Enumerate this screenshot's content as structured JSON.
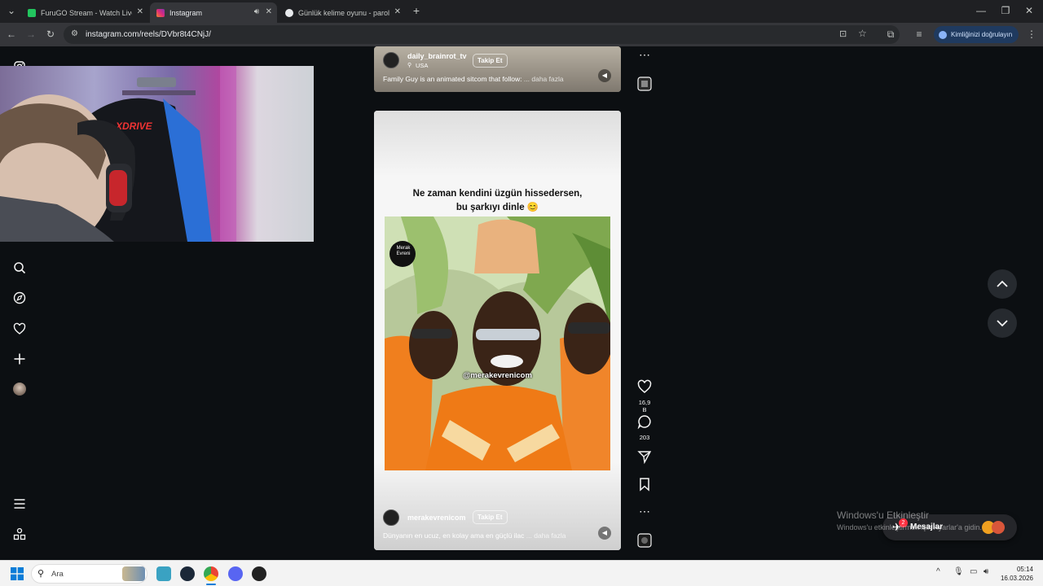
{
  "browser": {
    "tabs": [
      {
        "title": "FuruGO Stream - Watch Live on",
        "color": "#22c55e",
        "active": false
      },
      {
        "title": "Instagram",
        "color": "#e1306c",
        "active": true
      },
      {
        "title": "Günlük kelime oyunu - parolla",
        "color": "#e8eaed",
        "active": false
      }
    ],
    "new_tab_label": "+",
    "url": "instagram.com/reels/DVbr8t4CNjJ/",
    "verify_label": "Kimliğinizi doğrulayın"
  },
  "reel_top": {
    "username": "daily_brainrot_tv",
    "location": "USA",
    "follow_label": "Takip Et",
    "caption": "Family Guy is an animated sitcom that follow:",
    "more_label": "... daha fazla"
  },
  "reel_main": {
    "overlay_line1": "Ne zaman kendini üzgün hissedersen,",
    "overlay_line2": "bu şarkıyı dinle 😊",
    "watermark_handle": "@merakevrenicom",
    "logo_text_1": "Merak",
    "logo_text_2": "Evreni",
    "username": "merakevrenicom",
    "follow_label": "Takip Et",
    "caption": "Dünyanın en ucuz, en kolay ama en güçlü ilac",
    "more_label": "... daha fazla"
  },
  "actions": {
    "likes": "16,9 B",
    "comments": "203"
  },
  "webcam": {
    "chair_brand": "XDRIVE"
  },
  "windows": {
    "activate_title": "Windows'u Etkinleştir",
    "activate_sub": "Windows'u etkinleştirmek için Ayarlar'a gidin.",
    "messages_label": "Mesajlar",
    "messages_badge": "2",
    "search_placeholder": "Ara",
    "time": "05:14",
    "date": "16.03.2026"
  },
  "colors": {
    "instagram_bg": "#0c0f12",
    "reel_bg": "#f2f2f2",
    "follow_border": "#ffffff",
    "orange_shirt": "#f07f1e"
  }
}
